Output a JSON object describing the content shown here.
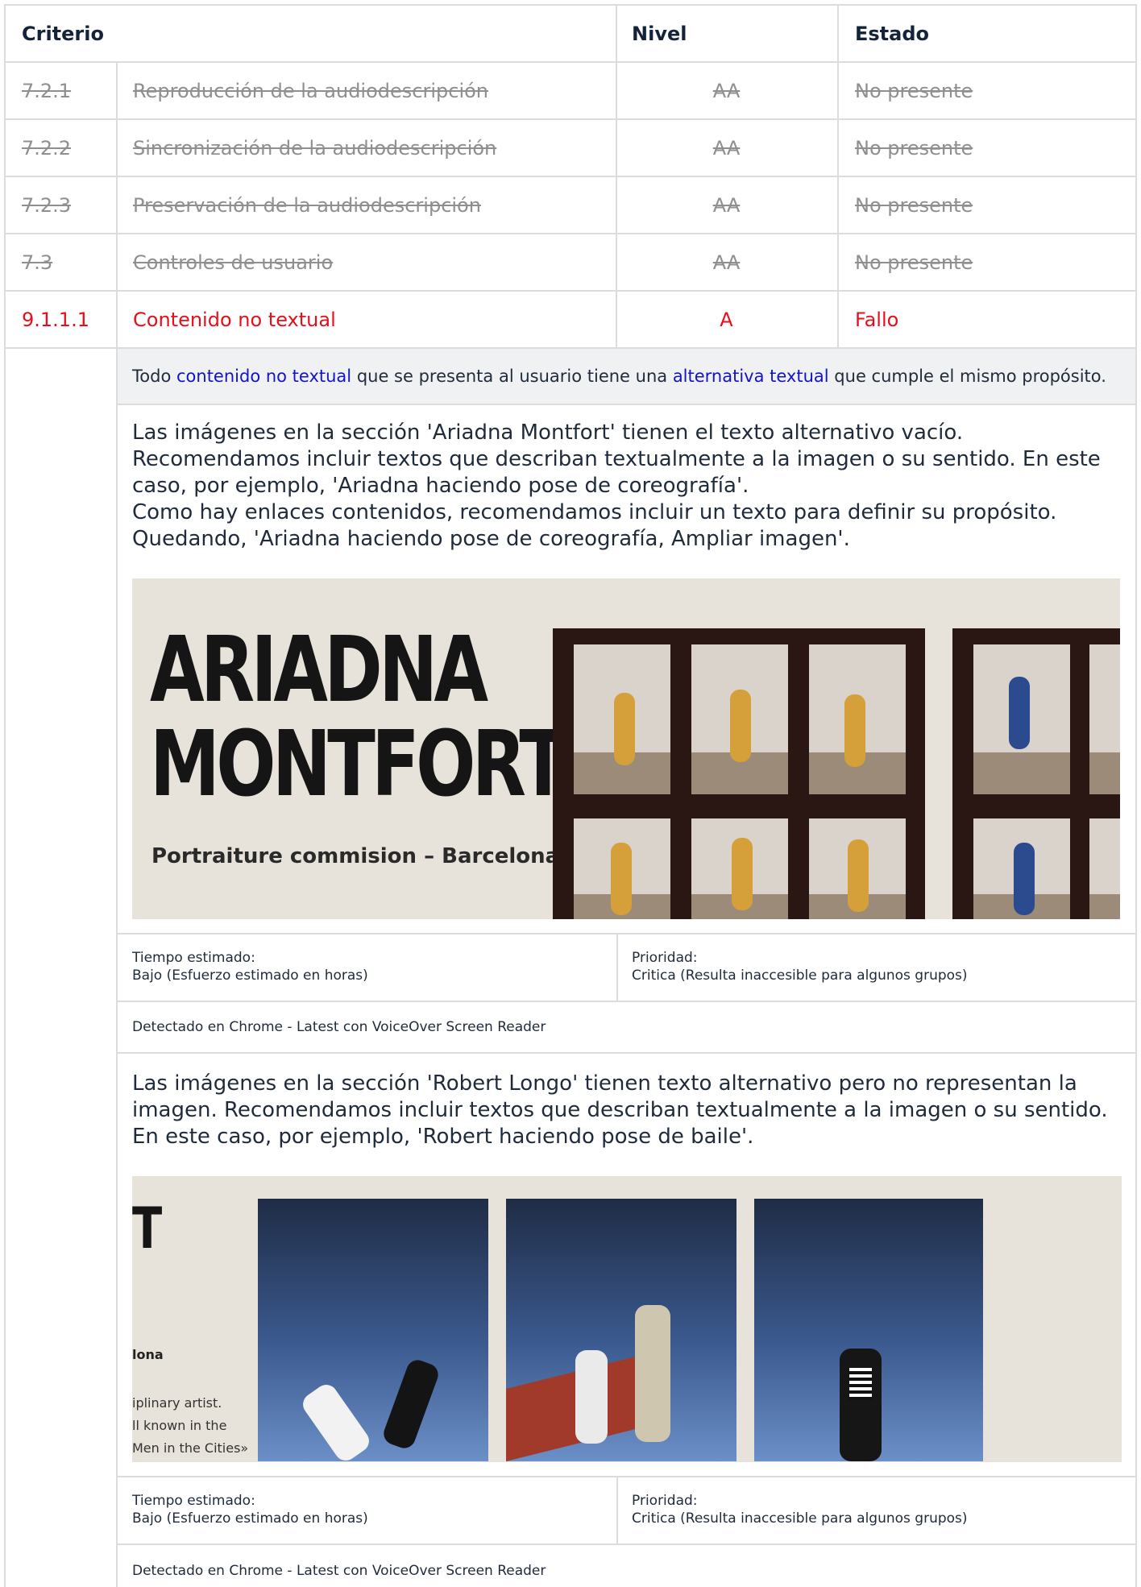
{
  "header": {
    "criterio": "Criterio",
    "nivel": "Nivel",
    "estado": "Estado"
  },
  "rows": [
    {
      "id": "7.2.1",
      "name": "Reproducción de la audiodescripción",
      "level": "AA",
      "status": "No presente"
    },
    {
      "id": "7.2.2",
      "name": "Sincronización de la audiodescripción",
      "level": "AA",
      "status": "No presente"
    },
    {
      "id": "7.2.3",
      "name": "Preservación de la audiodescripción",
      "level": "AA",
      "status": "No presente"
    },
    {
      "id": "7.3",
      "name": "Controles de usuario",
      "level": "AA",
      "status": "No presente"
    },
    {
      "id": "9.1.1.1",
      "name": "Contenido no textual",
      "level": "A",
      "status": "Fallo"
    }
  ],
  "detail": {
    "description": {
      "pre": "Todo ",
      "link1": "contenido no textual",
      "mid": " que se presenta al usuario tiene una ",
      "link2": "alternativa textual",
      "post": " que cumple el mismo propósito."
    },
    "findings": [
      {
        "text": "Las imágenes en la sección 'Ariadna Montfort' tienen el texto alternativo vacío. Recomendamos incluir textos que describan textualmente a la imagen o su sentido. En este caso, por ejemplo, 'Ariadna haciendo pose de coreografía'.",
        "text2": "Como hay enlaces contenidos, recomendamos incluir un texto para definir su propósito. Quedando, 'Ariadna haciendo pose de coreografía, Ampliar imagen'.",
        "screenshot": {
          "title_line1": "ARIADNA",
          "title_line2": "MONTFORT",
          "subtitle": "Portraiture commision – Barcelona"
        },
        "time_label": "Tiempo estimado:",
        "time_value": "Bajo (Esfuerzo estimado en horas)",
        "priority_label": "Prioridad:",
        "priority_value": "Critica (Resulta inaccesible para algunos grupos)",
        "detected": "Detectado en Chrome - Latest con VoiceOver Screen Reader"
      },
      {
        "text": "Las imágenes en la sección 'Robert Longo' tienen texto alternativo pero no representan la imagen. Recomendamos incluir textos que describan textualmente a la imagen o su sentido. En este caso, por ejemplo, 'Robert haciendo pose de baile'.",
        "screenshot": {
          "title_fragment": "T",
          "subtitle_fragment": "lona",
          "line1": "iplinary artist.",
          "line2": "ll known in the",
          "line3": "Men in the Cities»"
        },
        "time_label": "Tiempo estimado:",
        "time_value": "Bajo (Esfuerzo estimado en horas)",
        "priority_label": "Prioridad:",
        "priority_value": "Critica (Resulta inaccesible para algunos grupos)",
        "detected": "Detectado en Chrome - Latest con VoiceOver Screen Reader"
      }
    ]
  },
  "colors": {
    "fail": "#e60f1b",
    "link": "#1313c8",
    "na": "#8f8f8f",
    "header": "#14233a"
  }
}
